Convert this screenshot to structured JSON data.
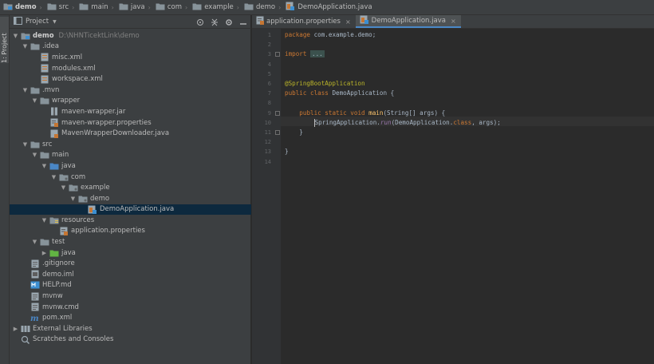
{
  "breadcrumb": [
    {
      "label": "demo",
      "icon": "module-folder-icon",
      "bold": true
    },
    {
      "label": "src",
      "icon": "folder-icon"
    },
    {
      "label": "main",
      "icon": "folder-icon"
    },
    {
      "label": "java",
      "icon": "folder-icon"
    },
    {
      "label": "com",
      "icon": "folder-icon"
    },
    {
      "label": "example",
      "icon": "folder-icon"
    },
    {
      "label": "demo",
      "icon": "folder-icon"
    },
    {
      "label": "DemoApplication.java",
      "icon": "java-class-icon"
    }
  ],
  "toolstrip": {
    "project_tab": "1: Project"
  },
  "project_panel": {
    "title": "Project",
    "tree": [
      {
        "depth": 0,
        "arrow": "down",
        "icon": "module-folder-icon",
        "label": "demo",
        "bold": true,
        "hint": "D:\\NHNTicektLink\\demo"
      },
      {
        "depth": 1,
        "arrow": "down",
        "icon": "folder-icon",
        "label": ".idea"
      },
      {
        "depth": 2,
        "arrow": "",
        "icon": "xml-file-icon",
        "label": "misc.xml"
      },
      {
        "depth": 2,
        "arrow": "",
        "icon": "xml-file-icon",
        "label": "modules.xml"
      },
      {
        "depth": 2,
        "arrow": "",
        "icon": "xml-file-icon",
        "label": "workspace.xml"
      },
      {
        "depth": 1,
        "arrow": "down",
        "icon": "folder-icon",
        "label": ".mvn"
      },
      {
        "depth": 2,
        "arrow": "down",
        "icon": "folder-icon",
        "label": "wrapper"
      },
      {
        "depth": 3,
        "arrow": "",
        "icon": "jar-file-icon",
        "label": "maven-wrapper.jar"
      },
      {
        "depth": 3,
        "arrow": "",
        "icon": "properties-file-icon",
        "label": "maven-wrapper.properties"
      },
      {
        "depth": 3,
        "arrow": "",
        "icon": "java-file-icon",
        "label": "MavenWrapperDownloader.java"
      },
      {
        "depth": 1,
        "arrow": "down",
        "icon": "folder-icon",
        "label": "src"
      },
      {
        "depth": 2,
        "arrow": "down",
        "icon": "folder-icon",
        "label": "main"
      },
      {
        "depth": 3,
        "arrow": "down",
        "icon": "source-folder-icon",
        "label": "java"
      },
      {
        "depth": 4,
        "arrow": "down",
        "icon": "package-icon",
        "label": "com"
      },
      {
        "depth": 5,
        "arrow": "down",
        "icon": "package-icon",
        "label": "example"
      },
      {
        "depth": 6,
        "arrow": "down",
        "icon": "package-icon",
        "label": "demo"
      },
      {
        "depth": 7,
        "arrow": "",
        "icon": "java-class-icon",
        "label": "DemoApplication.java",
        "selected": true
      },
      {
        "depth": 3,
        "arrow": "down",
        "icon": "resources-folder-icon",
        "label": "resources"
      },
      {
        "depth": 4,
        "arrow": "",
        "icon": "properties-file-icon",
        "label": "application.properties"
      },
      {
        "depth": 2,
        "arrow": "down",
        "icon": "folder-icon",
        "label": "test"
      },
      {
        "depth": 3,
        "arrow": "right",
        "icon": "test-folder-icon",
        "label": "java"
      },
      {
        "depth": 1,
        "arrow": "",
        "icon": "text-file-icon",
        "label": ".gitignore"
      },
      {
        "depth": 1,
        "arrow": "",
        "icon": "iml-file-icon",
        "label": "demo.iml"
      },
      {
        "depth": 1,
        "arrow": "",
        "icon": "markdown-file-icon",
        "label": "HELP.md"
      },
      {
        "depth": 1,
        "arrow": "",
        "icon": "text-file-icon",
        "label": "mvnw"
      },
      {
        "depth": 1,
        "arrow": "",
        "icon": "text-file-icon",
        "label": "mvnw.cmd"
      },
      {
        "depth": 1,
        "arrow": "",
        "icon": "maven-pom-icon",
        "label": "pom.xml"
      },
      {
        "depth": 0,
        "arrow": "right",
        "icon": "external-libraries-icon",
        "label": "External Libraries"
      },
      {
        "depth": 0,
        "arrow": "",
        "icon": "scratches-icon",
        "label": "Scratches and Consoles"
      }
    ]
  },
  "editor": {
    "tabs": [
      {
        "label": "application.properties",
        "icon": "properties-file-icon",
        "active": false
      },
      {
        "label": "DemoApplication.java",
        "icon": "java-class-icon",
        "active": true
      }
    ],
    "line_numbers": [
      "1",
      "2",
      "3",
      "4",
      "5",
      "6",
      "7",
      "8",
      "9",
      "10",
      "11",
      "12",
      "13",
      "14"
    ],
    "code": {
      "l1_kw": "package",
      "l1_rest": " com.example.demo;",
      "l3_kw": "import",
      "l3_fold": "...",
      "l6_ann": "@SpringBootApplication",
      "l7_kw": "public class",
      "l7_rest": " DemoApplication {",
      "l9_kw": "public static void",
      "l9_fn": " main",
      "l9_rest": "(String[] args) {",
      "l10_a": "SpringApplication.",
      "l10_fn": "run",
      "l10_b": "(DemoApplication.",
      "l10_kw": "class",
      "l10_c": ", args);",
      "l11": "}",
      "l13": "}"
    }
  },
  "colors": {
    "background": "#2b2b2b",
    "panel": "#3c3f41",
    "selection": "#0d293e",
    "keyword": "#cc7832",
    "annotation": "#bbb529",
    "method": "#ffc66d",
    "tab_underline": "#4a88c7"
  }
}
